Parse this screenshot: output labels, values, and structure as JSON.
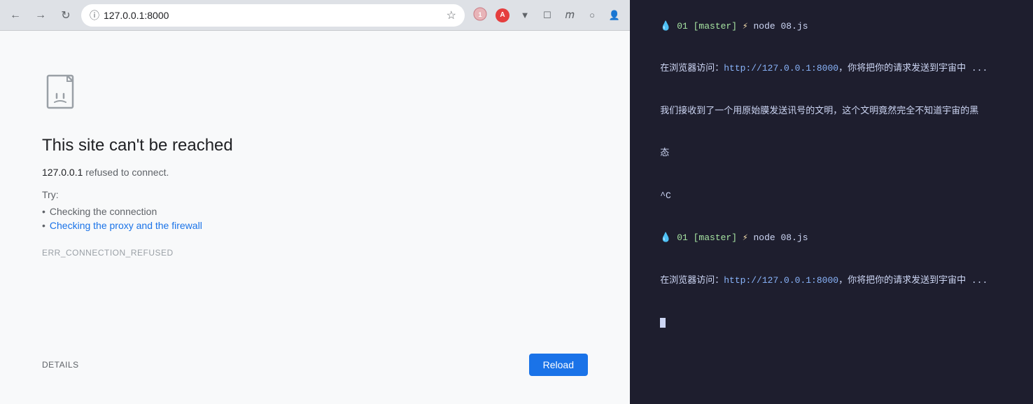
{
  "browser": {
    "address": "127.0.0.1:8000",
    "favicon_label": "info",
    "bookmark_label": "☆",
    "error": {
      "title": "This site can't be reached",
      "subtitle_host": "127.0.0.1",
      "subtitle_text": " refused to connect.",
      "try_label": "Try:",
      "suggestion_1": "Checking the connection",
      "suggestion_2": "Checking the proxy and the firewall",
      "error_code": "ERR_CONNECTION_REFUSED"
    },
    "details_label": "DETAILS",
    "reload_label": "Reload"
  },
  "terminal": {
    "lines": [
      {
        "type": "prompt",
        "text": "💧 01 [master] ⚡ node 08.js"
      },
      {
        "type": "output",
        "text": "在浏览器访问：http://127.0.0.1:8000，你将把你的请求发送到宇宙中 ..."
      },
      {
        "type": "output",
        "text": "我们接收到了一个用原始膜发送讯号的文明，这个文明竟然完全不知道宇宙的黑态"
      },
      {
        "type": "output",
        "text": "^C"
      },
      {
        "type": "prompt",
        "text": "💧 01 [master] ⚡ node 08.js"
      },
      {
        "type": "output",
        "text": "在浏览器访问：http://127.0.0.1:8000，你将把你的请求发送到宇宙中 ..."
      },
      {
        "type": "cursor",
        "text": ""
      }
    ]
  }
}
